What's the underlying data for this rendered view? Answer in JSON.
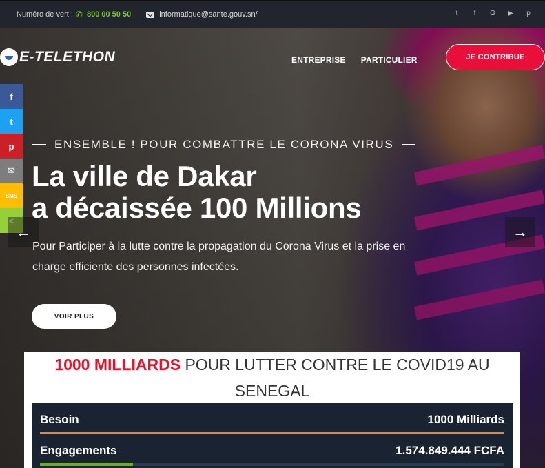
{
  "topbar": {
    "phone_label": "Numéro de vert :",
    "phone_number": "800 00 50 50",
    "email": "informatique@sante.gouv.sn/",
    "socials": [
      "twitter-icon",
      "facebook-icon",
      "google-plus-icon",
      "youtube-icon",
      "pinterest-icon"
    ]
  },
  "brand": {
    "logo_text": "E-TELETHON"
  },
  "nav": {
    "items": [
      "ENTREPRISE",
      "PARTICULIER"
    ],
    "cta": "JE CONTRIBUE"
  },
  "share": [
    {
      "icon": "facebook-icon",
      "glyph": "f",
      "color": "#3b5998"
    },
    {
      "icon": "twitter-icon",
      "glyph": "t",
      "color": "#1da1f2"
    },
    {
      "icon": "pinterest-icon",
      "glyph": "p",
      "color": "#cb2027"
    },
    {
      "icon": "email-icon",
      "glyph": "✉",
      "color": "#7d7d7d"
    },
    {
      "icon": "sms-icon",
      "glyph": "SMS",
      "color": "#ffbd00"
    },
    {
      "icon": "share-icon",
      "glyph": "<",
      "color": "#95d03a"
    }
  ],
  "slide": {
    "kicker": "ENSEMBLE ! POUR COMBATTRE LE CORONA VIRUS",
    "headline_line1": "La ville de Dakar",
    "headline_line2": "a décaissée 100 Millions",
    "description": "Pour Participer à la lutte contre la propagation du Corona Virus et la prise en charge efficiente des personnes infectées.",
    "button": "VOIR PLUS",
    "prev_glyph": "←",
    "next_glyph": "→"
  },
  "fund": {
    "title_amount": "1000 MILLIARDS",
    "title_rest": " POUR LUTTER CONTRE LE COVID19 AU SENEGAL",
    "rows": [
      {
        "label": "Besoin",
        "value": "1000 Milliards"
      },
      {
        "label": "Engagements",
        "value": "1.574.849.444 FCFA"
      }
    ],
    "engagement_progress_percent": 20,
    "colors": {
      "need_bar": "#f3822b",
      "engagement_bar": "#6aae2a",
      "accent": "#e8102a"
    }
  }
}
